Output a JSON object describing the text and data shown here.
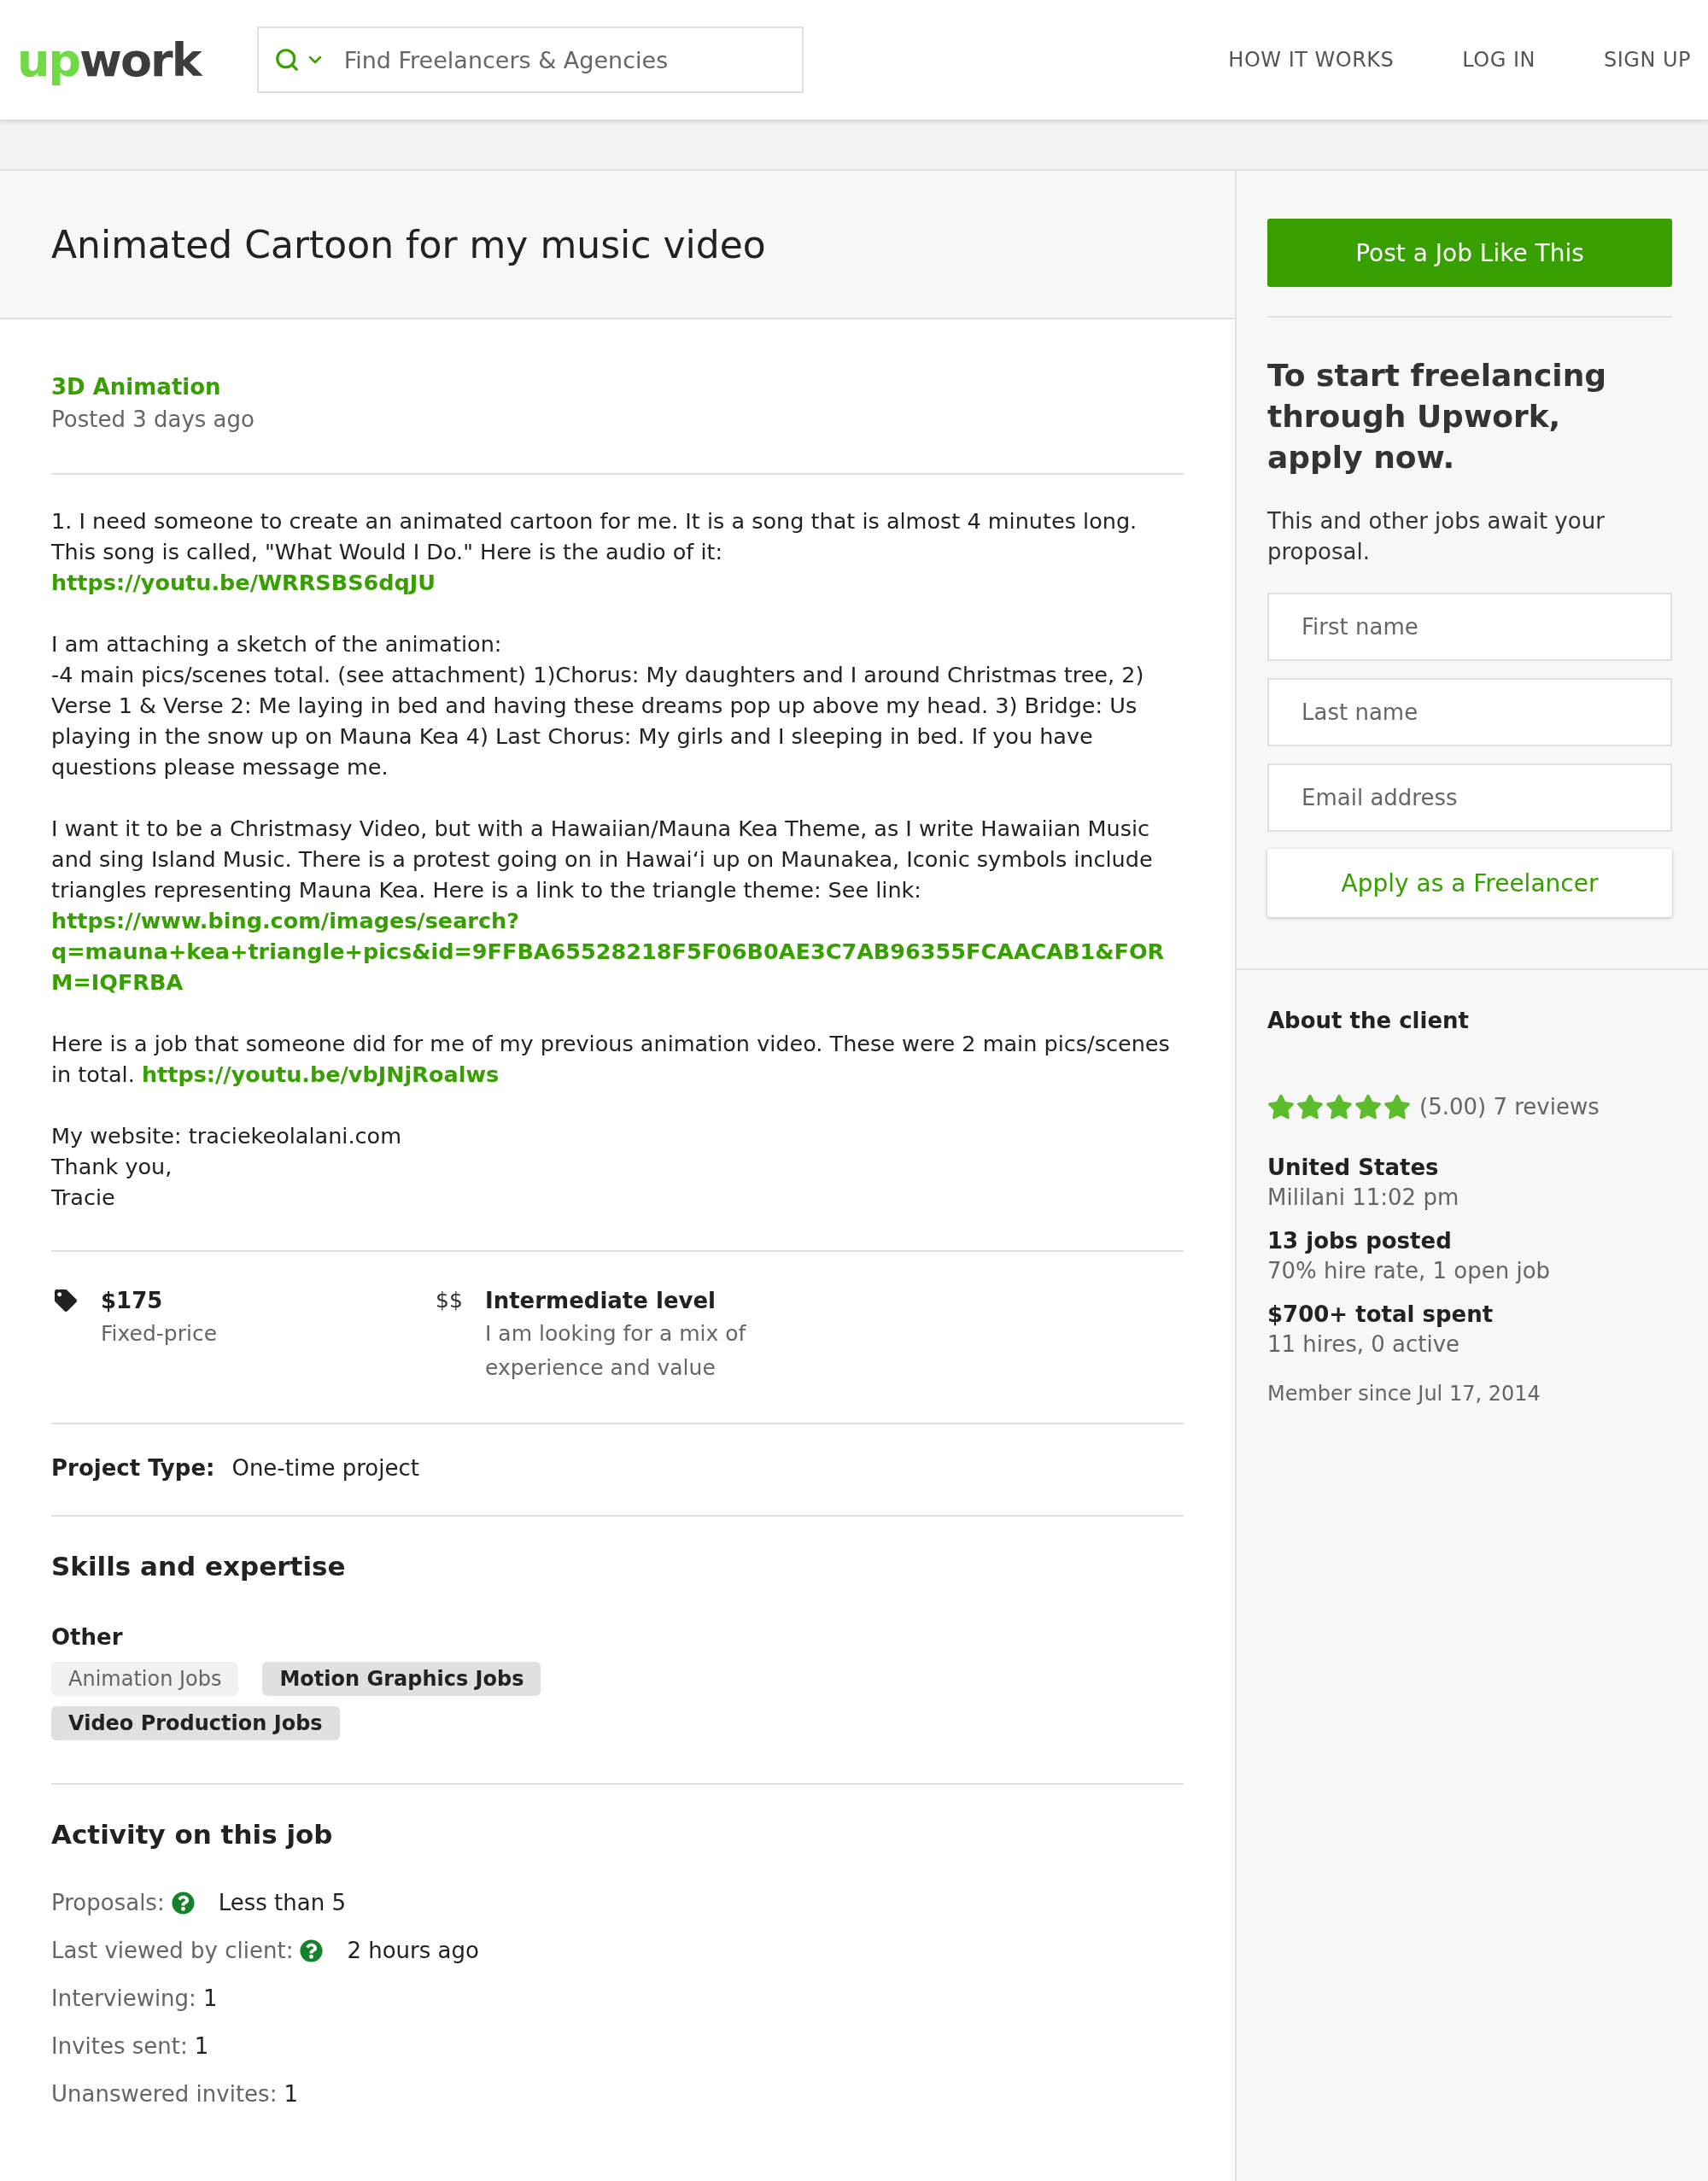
{
  "header": {
    "logo": {
      "part_1": "up",
      "part_2": "work"
    },
    "search": {
      "placeholder": "Find Freelancers & Agencies"
    },
    "nav": [
      "HOW IT WORKS",
      "LOG IN",
      "SIGN UP"
    ]
  },
  "job": {
    "title": "Animated Cartoon for my music video",
    "category": "3D Animation",
    "posted": "Posted 3 days ago",
    "description": [
      {
        "lines": [
          [
            {
              "kind": "text",
              "text": "1. I need someone to create an animated cartoon for me.  It is a song that is almost 4 minutes long.  This song is called, \"What Would I Do.\" Here is the audio of it:"
            }
          ],
          [
            {
              "kind": "link",
              "text": "https://youtu.be/WRRSBS6dqJU"
            }
          ]
        ]
      },
      {
        "lines": [
          [
            {
              "kind": "text",
              "text": "I am attaching a sketch of the animation:"
            }
          ],
          [
            {
              "kind": "text",
              "text": "-4 main pics/scenes total. (see attachment)  1)Chorus:  My daughters and I around Christmas tree, 2) Verse 1 & Verse 2: Me laying in bed and having these dreams pop up above my head. 3) Bridge: Us playing in the snow up on Mauna Kea 4) Last Chorus:  My girls and I sleeping in bed.  If you have questions please message me."
            }
          ]
        ]
      },
      {
        "lines": [
          [
            {
              "kind": "text",
              "text": "I want it to be a Christmasy Video, but with a Hawaiian/Mauna Kea Theme, as I write Hawaiian Music and sing Island Music. There is a protest going on in Hawaiʻi up on Maunakea, Iconic symbols include triangles representing Mauna Kea. Here is a link to the triangle theme: See link:"
            }
          ],
          [
            {
              "kind": "longlink",
              "text": "https://www.bing.com/images/search?q=mauna+kea+triangle+pics&id=9FFBA65528218F5F06B0AE3C7AB96355FCAACAB1&FORM=IQFRBA"
            }
          ]
        ]
      },
      {
        "lines": [
          [
            {
              "kind": "text",
              "text": "Here is a job that someone did for me of my previous animation video. These were 2 main pics/scenes in total. "
            },
            {
              "kind": "link",
              "text": "https://youtu.be/vbJNjRoalws"
            }
          ]
        ]
      },
      {
        "lines": [
          [
            {
              "kind": "text",
              "text": "My website: traciekeolalani.com"
            }
          ],
          [
            {
              "kind": "text",
              "text": "Thank you,"
            }
          ],
          [
            {
              "kind": "text",
              "text": "Tracie"
            }
          ]
        ]
      }
    ],
    "terms": [
      {
        "kind": "price",
        "title": "$175",
        "detail": "Fixed-price"
      },
      {
        "kind": "level",
        "symbol": "$$",
        "title": "Intermediate level",
        "detail": "I am looking for a mix of experience and value"
      }
    ],
    "project_type": {
      "label": "Project Type:",
      "value": "One-time project"
    },
    "skills": {
      "heading": "Skills and expertise",
      "group": "Other",
      "tags": [
        {
          "label": "Animation Jobs",
          "highlighted": false
        },
        {
          "label": "Motion Graphics Jobs",
          "highlighted": true
        },
        {
          "label": "Video Production Jobs",
          "highlighted": true
        }
      ]
    },
    "activity": {
      "heading": "Activity on this job",
      "rows": [
        {
          "label": "Proposals:",
          "help": true,
          "value": "Less than 5"
        },
        {
          "label": "Last viewed by client:",
          "help": true,
          "value": "2 hours ago"
        },
        {
          "label": "Interviewing:",
          "help": false,
          "value": "1"
        },
        {
          "label": "Invites sent:",
          "help": false,
          "value": "1"
        },
        {
          "label": "Unanswered invites:",
          "help": false,
          "value": "1"
        }
      ]
    }
  },
  "sidebar": {
    "post_button": "Post a Job Like This",
    "pitch": "To start freelancing through Upwork, apply now.",
    "pitch_detail": "This and other jobs await your proposal.",
    "fields": [
      {
        "placeholder": "First name"
      },
      {
        "placeholder": "Last name"
      },
      {
        "placeholder": "Email address"
      }
    ],
    "apply_button": "Apply as a Freelancer",
    "client": {
      "heading": "About the client",
      "stars": 5,
      "rating": "(5.00) 7 reviews",
      "stats": [
        {
          "title": "United States",
          "detail": "Mililani 11:02 pm"
        },
        {
          "title": "13 jobs posted",
          "detail": "70% hire rate, 1 open job"
        },
        {
          "title": "$700+ total spent",
          "detail": "11 hires, 0 active"
        }
      ],
      "member_since": "Member since Jul 17, 2014"
    }
  }
}
